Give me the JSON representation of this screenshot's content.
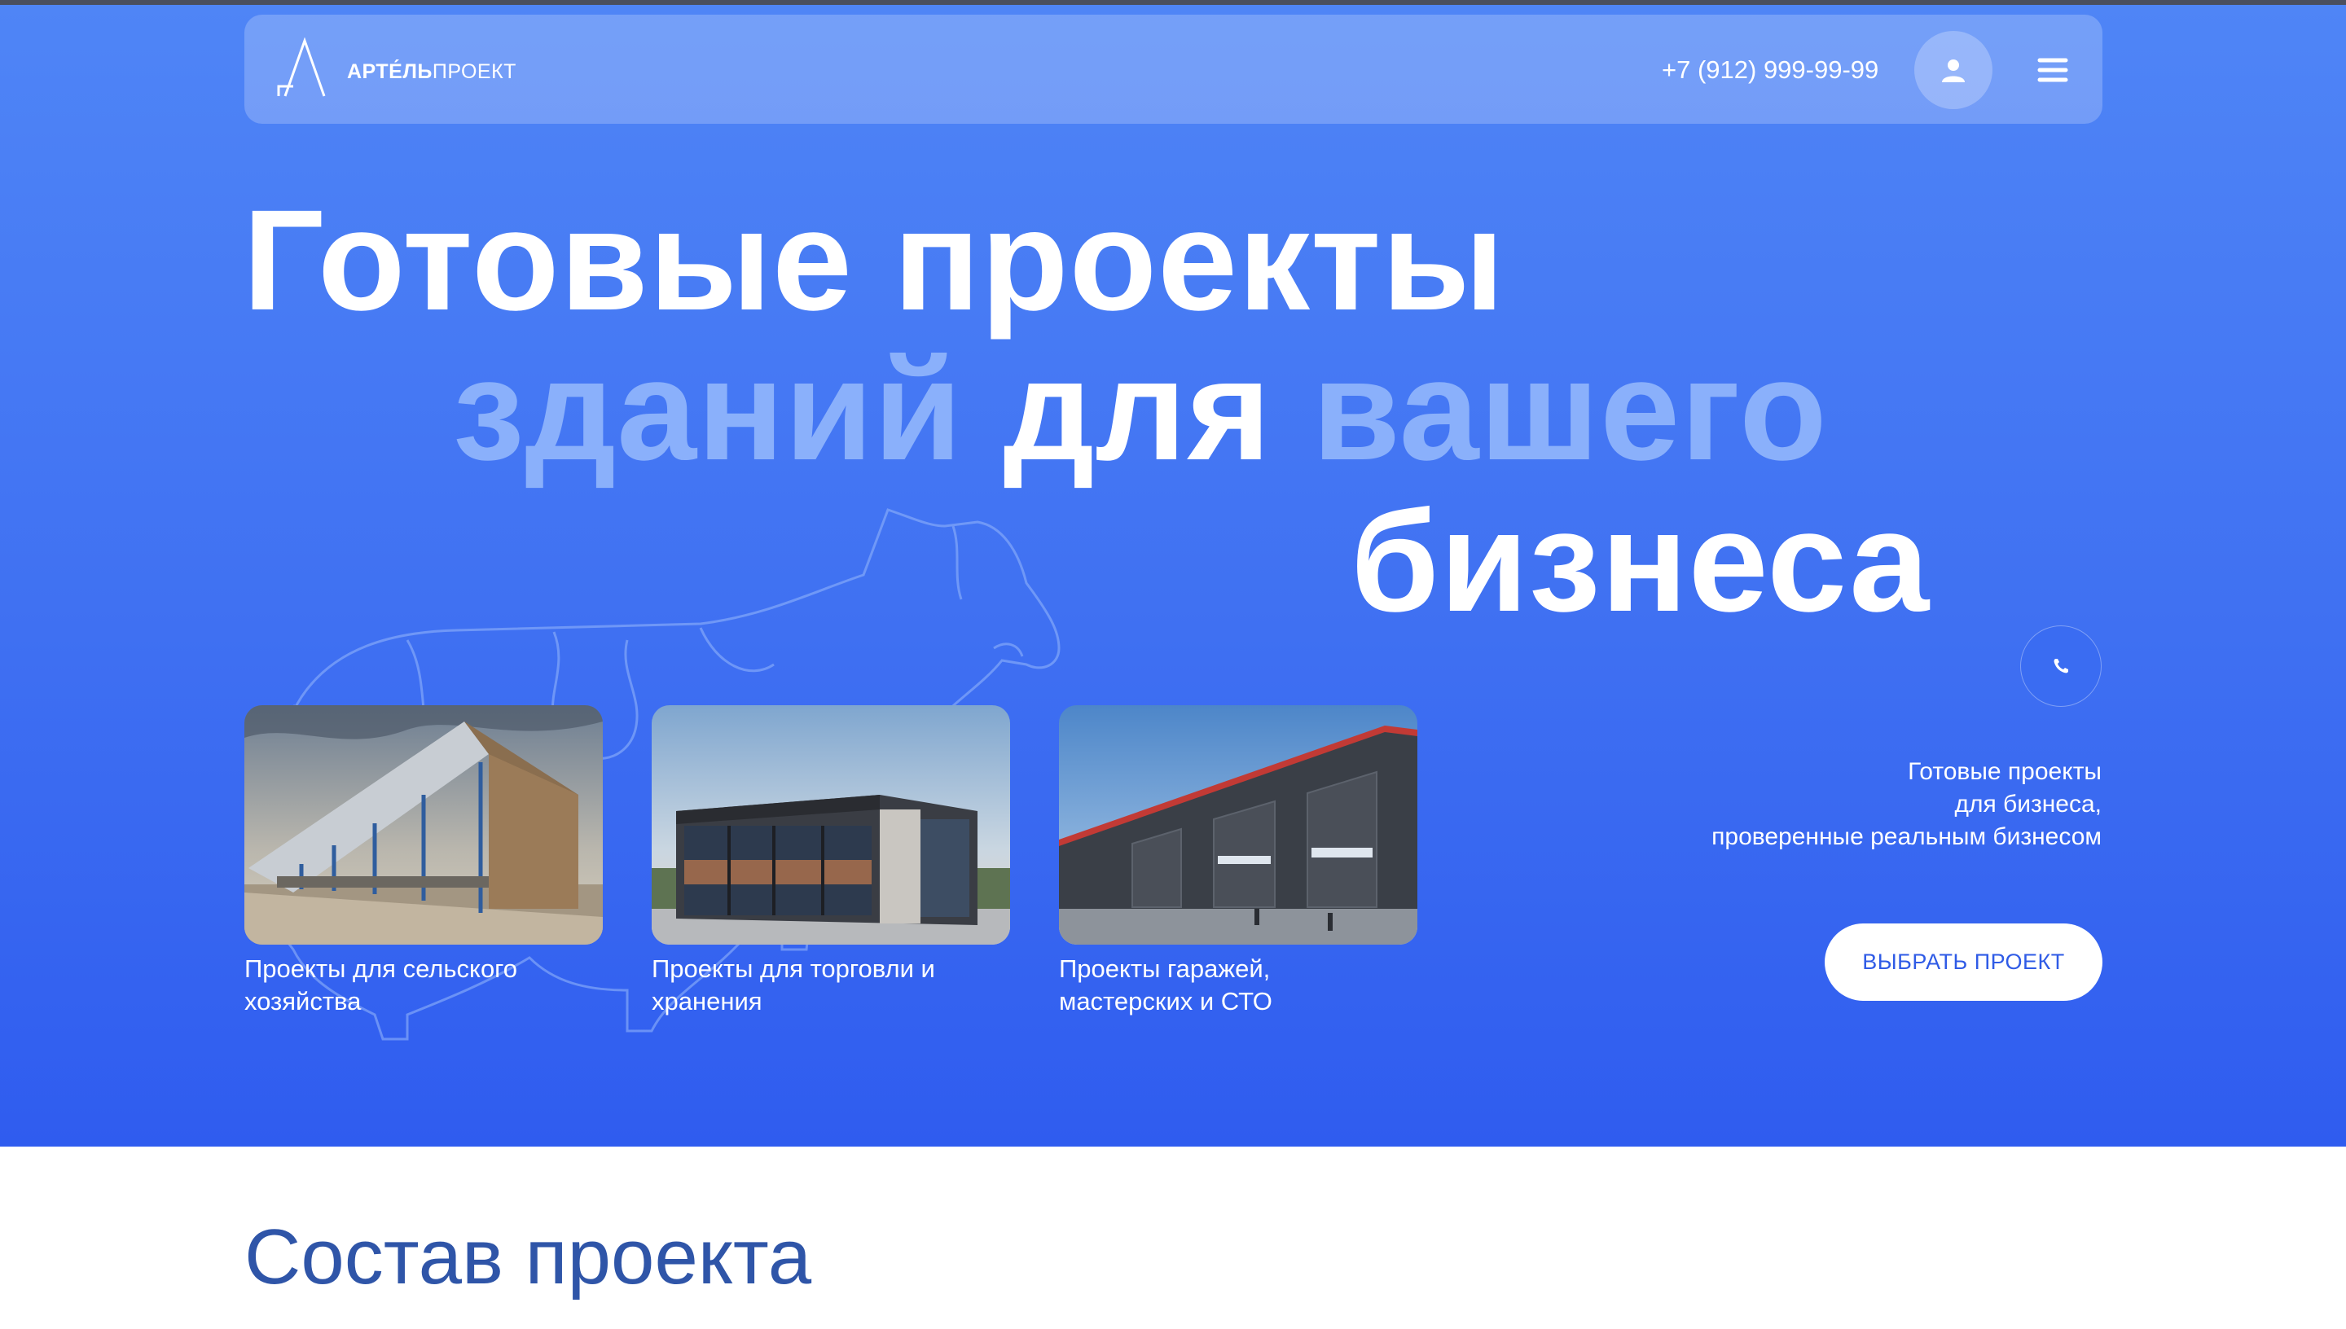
{
  "header": {
    "logo_bold": "АРТЕ́ЛЬ",
    "logo_light": "ПРОЕКТ",
    "phone": "+7 (912) 999-99-99",
    "user_icon": "user-icon",
    "menu_icon": "hamburger-menu-icon"
  },
  "hero": {
    "line1": "Готовые проекты",
    "line2_a": "зданий",
    "line2_b": "для",
    "line2_c": "вашего",
    "line3": "бизнеса",
    "call_icon": "phone-icon",
    "description": [
      "Готовые проекты",
      "для бизнеса,",
      "проверенные реальным бизнесом"
    ],
    "cta_label": "ВЫБРАТЬ ПРОЕКТ"
  },
  "cards": [
    {
      "title": "Проекты для сельского хозяйства"
    },
    {
      "title": "Проекты для торговли и хранения"
    },
    {
      "title": "Проекты гаражей, мастерских и СТО"
    }
  ],
  "section": {
    "title": "Состав проекта"
  },
  "colors": {
    "hero_top": "#4f85f6",
    "hero_bottom": "#2f5cef",
    "accent_pale_text": "#8ab0fb",
    "cta_text": "#2f5be6",
    "section_title": "#2f55a8"
  }
}
